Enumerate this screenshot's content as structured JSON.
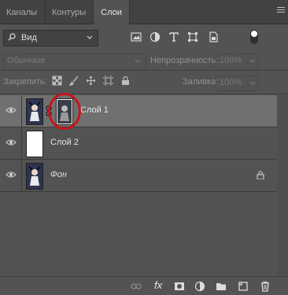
{
  "tabs": [
    "Каналы",
    "Контуры",
    "Слои"
  ],
  "active_tab": "Слои",
  "filter": {
    "label": "Вид"
  },
  "blend_mode": "Обычные",
  "opacity": {
    "label": "Непрозрачность:",
    "value": "100%"
  },
  "lock": {
    "label": "Закрепить:"
  },
  "fill": {
    "label": "Заливка:",
    "value": "100%"
  },
  "layers": [
    {
      "name": "Слой 1",
      "selected": true,
      "type": "smart-mask"
    },
    {
      "name": "Слой 2",
      "selected": false,
      "type": "white"
    },
    {
      "name": "Фон",
      "selected": false,
      "type": "background",
      "locked": true
    }
  ],
  "bottom": {
    "fx_label": "fx"
  },
  "colors": {
    "panel": "#535353",
    "selected_layer": "#707070",
    "highlight_circle": "#c5151b"
  }
}
